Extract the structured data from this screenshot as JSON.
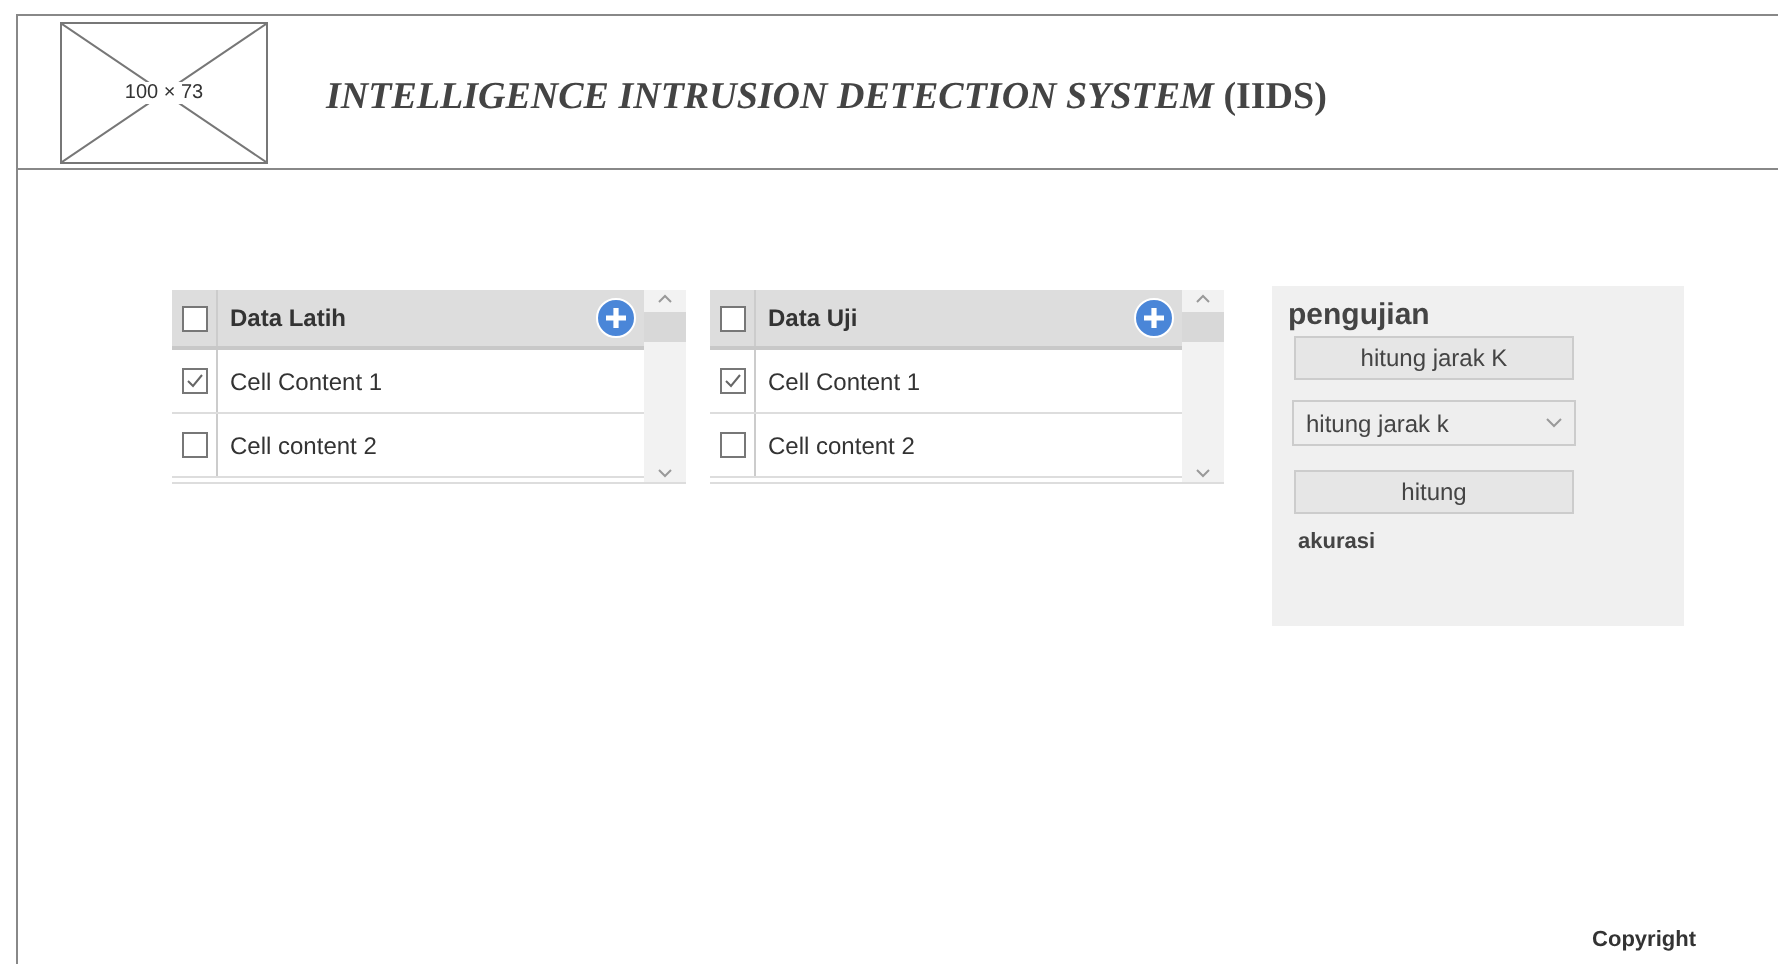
{
  "header": {
    "logo_placeholder": "100 × 73",
    "title": "*INTELLIGENCE INTRUSION DETECTION SYSTEM* (IIDS)"
  },
  "tables": [
    {
      "title": "Data Latih",
      "header_checked": false,
      "rows": [
        {
          "label": "Cell Content 1",
          "checked": true
        },
        {
          "label": "Cell content 2",
          "checked": false
        }
      ]
    },
    {
      "title": "Data Uji",
      "header_checked": false,
      "rows": [
        {
          "label": "Cell Content 1",
          "checked": true
        },
        {
          "label": "Cell content 2",
          "checked": false
        }
      ]
    }
  ],
  "panel": {
    "title": "pengujian",
    "button_1": "hitung jarak K",
    "select_value": "hitung jarak k",
    "button_2": "hitung",
    "result_label": "akurasi"
  },
  "footer": {
    "copyright": "Copyright"
  }
}
